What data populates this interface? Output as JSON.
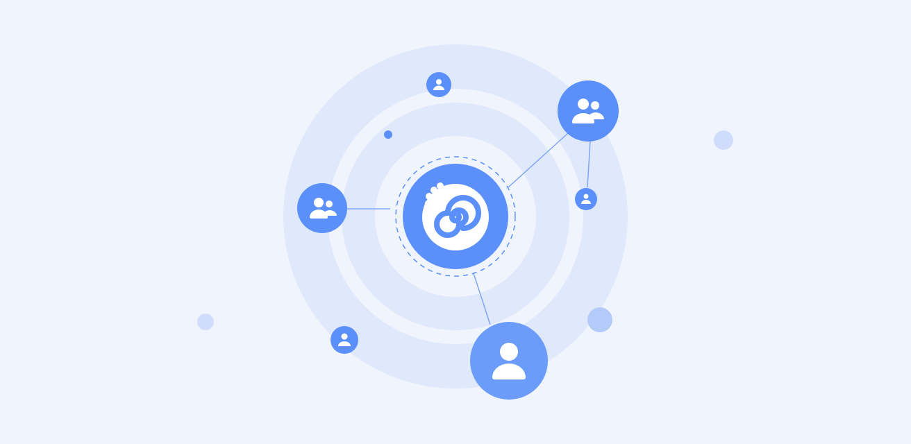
{
  "colors": {
    "background": "#eff4fd",
    "ring": "#dfe9fb",
    "accent": "#5b8ff9",
    "node_light": "#6b9cfa",
    "connector": "#7ea6f5",
    "decor_dot": "#cfdcfb",
    "decor_dot_strong": "#b4cbfa",
    "icon_fill": "#ffffff"
  },
  "hub": {
    "icon": "spiral-logo-icon"
  },
  "nodes": [
    {
      "id": "group-top-right",
      "icon": "users-icon"
    },
    {
      "id": "group-left",
      "icon": "users-icon"
    },
    {
      "id": "user-bottom-large",
      "icon": "user-icon"
    },
    {
      "id": "user-top-small",
      "icon": "user-icon"
    },
    {
      "id": "user-right-small",
      "icon": "user-icon"
    },
    {
      "id": "user-bottom-left-small",
      "icon": "user-icon"
    }
  ],
  "connections": [
    {
      "from": "hub",
      "to": "group-top-right"
    },
    {
      "from": "group-top-right",
      "to": "user-right-small"
    },
    {
      "from": "hub",
      "to": "group-left"
    },
    {
      "from": "hub",
      "to": "user-bottom-large"
    }
  ]
}
